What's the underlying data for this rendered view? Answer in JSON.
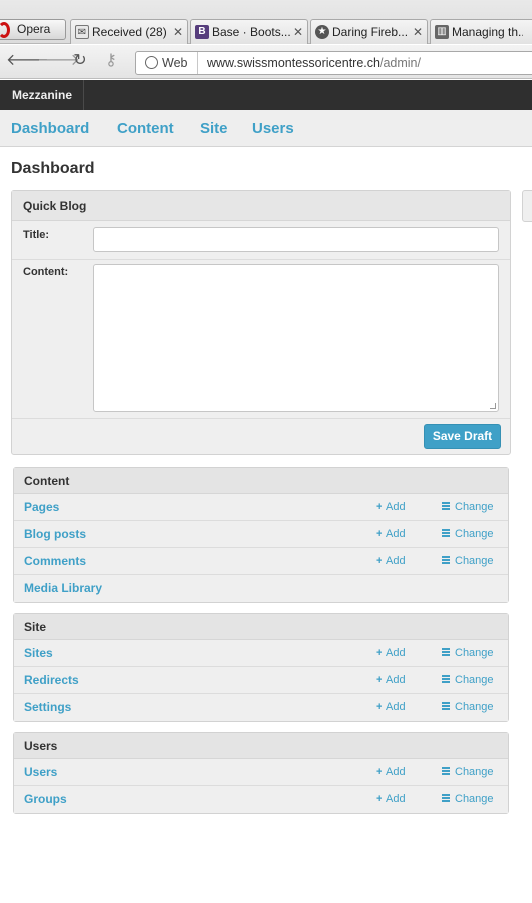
{
  "browser": {
    "menu_button": "Opera",
    "tabs": [
      {
        "label": "Received (28)",
        "favicon": "mail-icon"
      },
      {
        "label": "Base · Boots...",
        "favicon": "bootstrap-icon"
      },
      {
        "label": "Daring Fireb...",
        "favicon": "star-icon"
      },
      {
        "label": "Managing th...",
        "favicon": "book-icon"
      }
    ],
    "address": {
      "chip": "Web",
      "domain": "www.swissmontessoricentre.ch",
      "path": "/admin/"
    }
  },
  "admin": {
    "brand": "Mezzanine",
    "nav": [
      "Dashboard",
      "Content",
      "Site",
      "Users"
    ],
    "page_title": "Dashboard",
    "quick_blog": {
      "title": "Quick Blog",
      "title_label": "Title:",
      "title_value": "",
      "content_label": "Content:",
      "content_value": "",
      "save_label": "Save Draft"
    },
    "add_label": "Add",
    "change_label": "Change",
    "modules": [
      {
        "title": "Content",
        "rows": [
          {
            "label": "Pages",
            "actions": true
          },
          {
            "label": "Blog posts",
            "actions": true
          },
          {
            "label": "Comments",
            "actions": true
          },
          {
            "label": "Media Library",
            "actions": false
          }
        ]
      },
      {
        "title": "Site",
        "rows": [
          {
            "label": "Sites",
            "actions": true
          },
          {
            "label": "Redirects",
            "actions": true
          },
          {
            "label": "Settings",
            "actions": true
          }
        ]
      },
      {
        "title": "Users",
        "rows": [
          {
            "label": "Users",
            "actions": true
          },
          {
            "label": "Groups",
            "actions": true
          }
        ]
      }
    ]
  },
  "colors": {
    "accent": "#3fa0c7",
    "header_bg": "#2f2f2f",
    "panel_bg": "#efefef"
  }
}
